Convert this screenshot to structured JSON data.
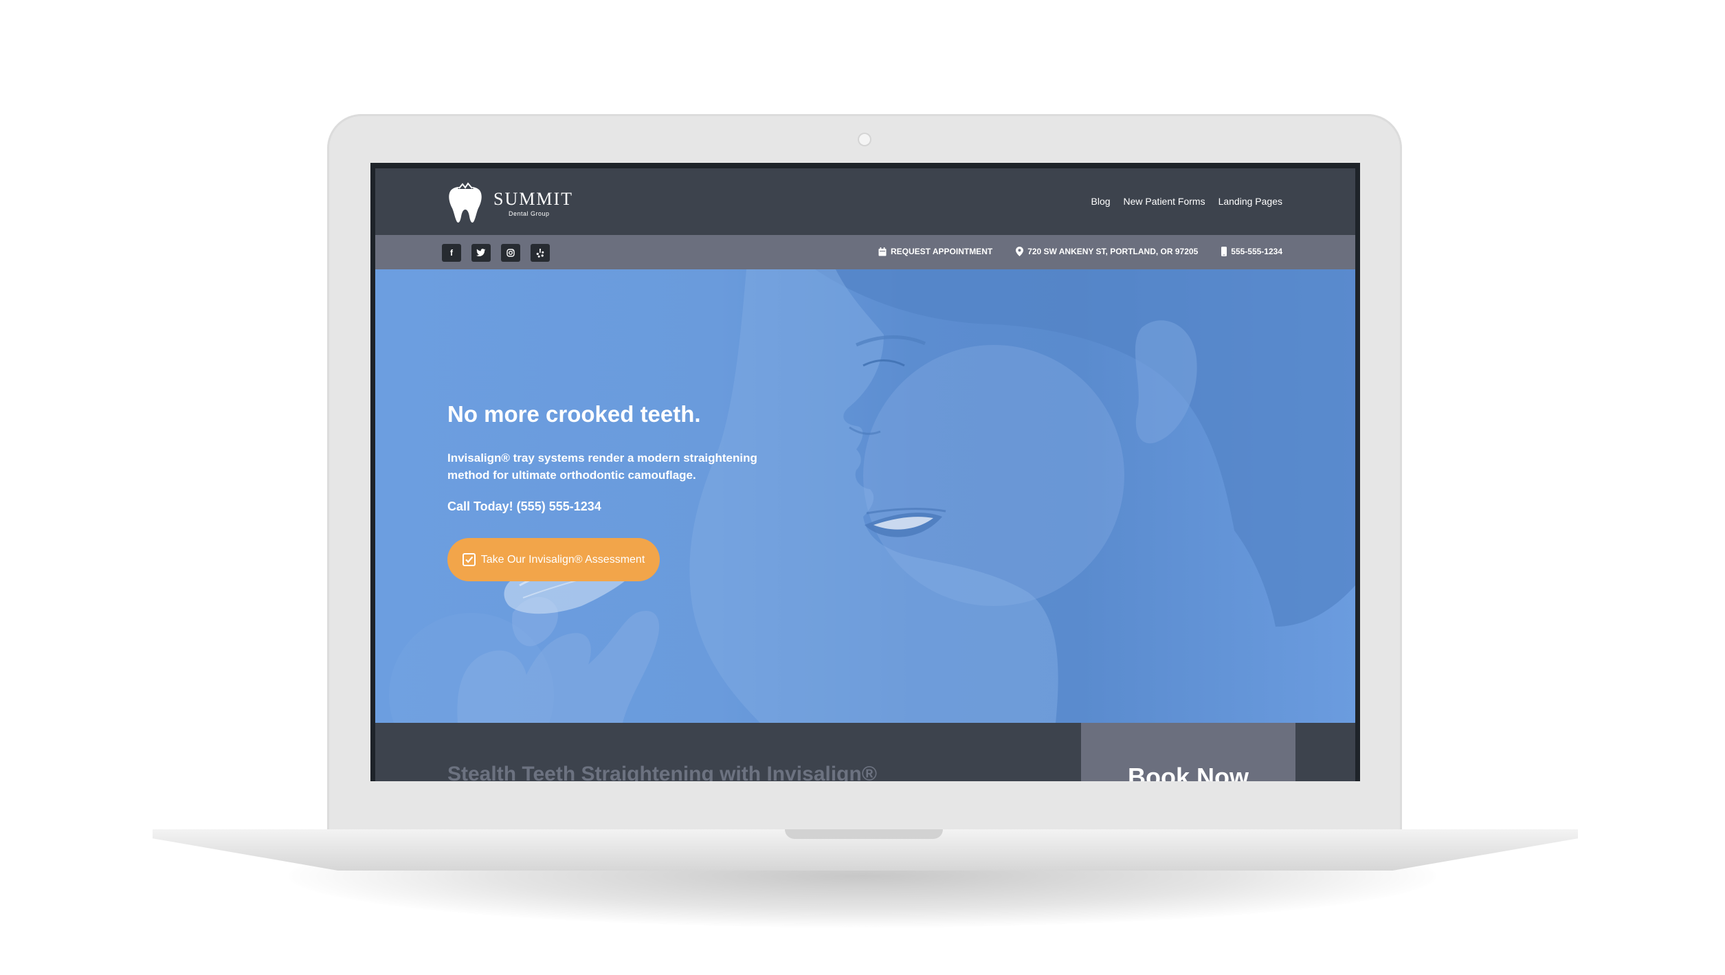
{
  "brand": {
    "name": "SUMMIT",
    "tagline": "Dental Group"
  },
  "nav": {
    "links": [
      "Blog",
      "New Patient Forms",
      "Landing Pages"
    ]
  },
  "utility": {
    "socials": [
      "facebook-icon",
      "twitter-icon",
      "instagram-icon",
      "yelp-icon"
    ],
    "request_appointment": "REQUEST APPOINTMENT",
    "address": "720 SW ANKENY ST, PORTLAND, OR 97205",
    "phone": "555-555-1234"
  },
  "hero": {
    "title": "No more crooked teeth.",
    "description": "Invisalign® tray systems render a modern straightening method for ultimate orthodontic camouflage.",
    "call": "Call Today! (555) 555-1234",
    "cta_label": "Take Our Invisalign® Assessment"
  },
  "section": {
    "title": "Stealth Teeth Straightening with Invisalign®",
    "book_label": "Book Now"
  },
  "colors": {
    "header_bg": "#3d434d",
    "utility_bg": "#6b6f7e",
    "hero_blue": "#6a9bdc",
    "cta_orange": "#f2a54a"
  }
}
